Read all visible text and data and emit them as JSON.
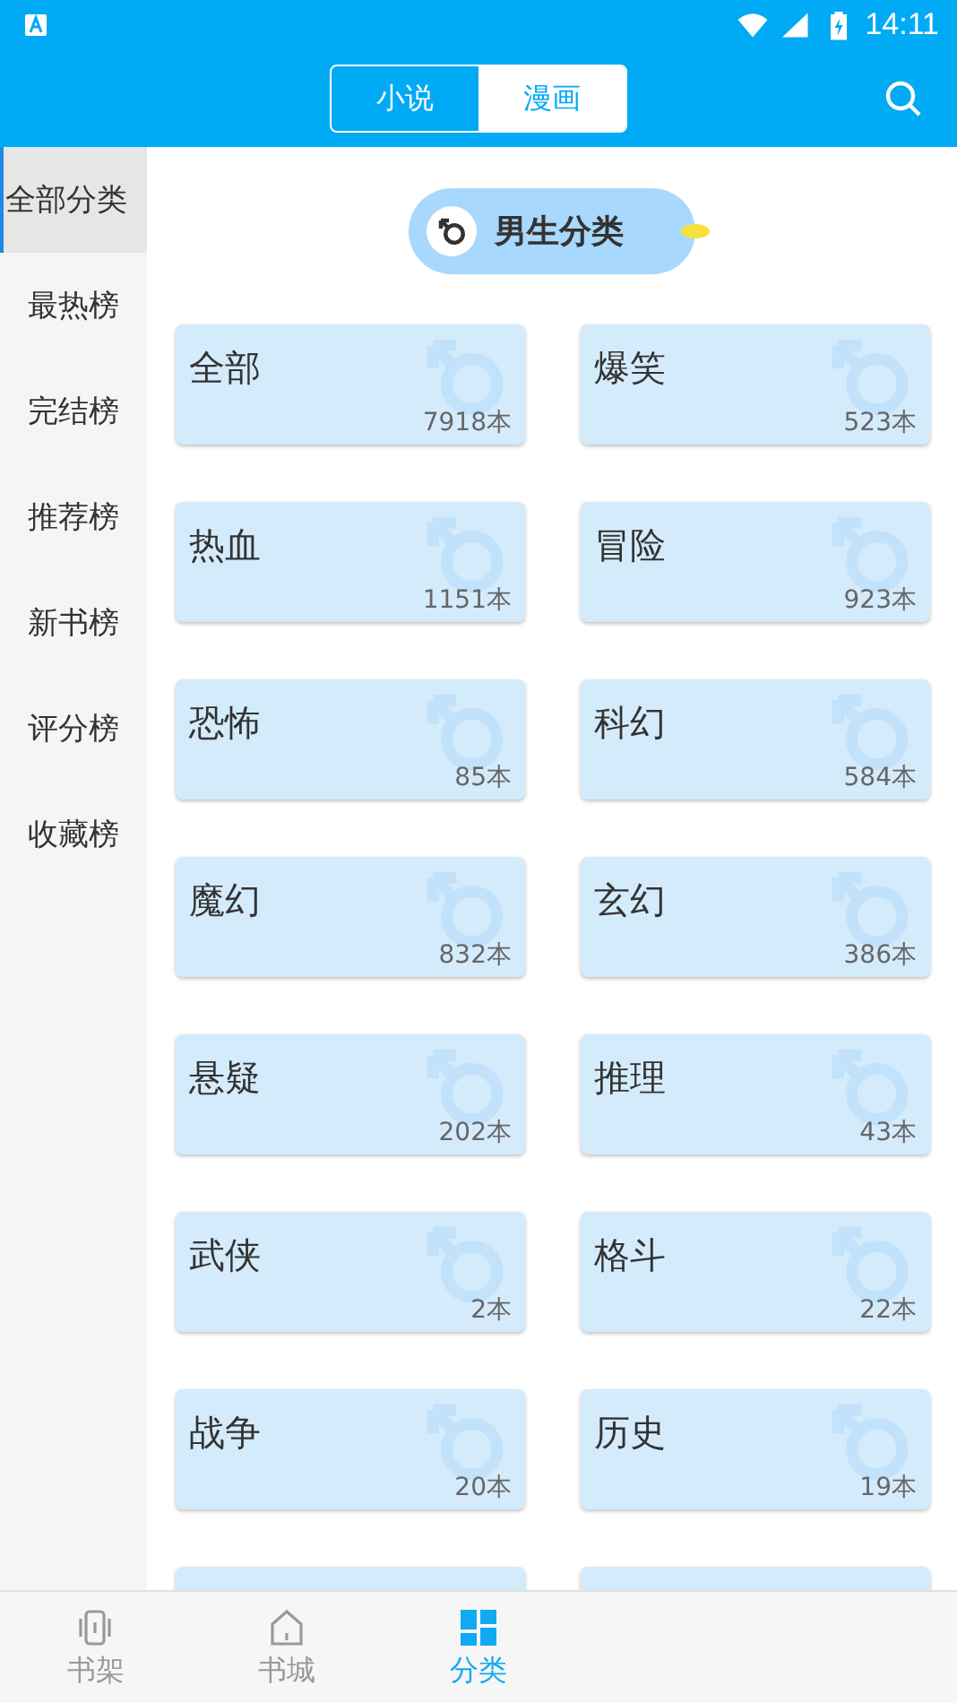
{
  "status_bar": {
    "time": "14:11"
  },
  "header": {
    "tabs": [
      {
        "label": "小说",
        "selected": false
      },
      {
        "label": "漫画",
        "selected": true
      }
    ]
  },
  "sidebar": {
    "items": [
      {
        "label": "全部分类",
        "selected": true
      },
      {
        "label": "最热榜",
        "selected": false
      },
      {
        "label": "完结榜",
        "selected": false
      },
      {
        "label": "推荐榜",
        "selected": false
      },
      {
        "label": "新书榜",
        "selected": false
      },
      {
        "label": "评分榜",
        "selected": false
      },
      {
        "label": "收藏榜",
        "selected": false
      }
    ]
  },
  "section": {
    "title": "男生分类"
  },
  "categories": [
    {
      "kind": "card",
      "name": "全部",
      "count": "7918本"
    },
    {
      "kind": "card",
      "name": "爆笑",
      "count": "523本"
    },
    {
      "kind": "card",
      "name": "热血",
      "count": "1151本"
    },
    {
      "kind": "card",
      "name": "冒险",
      "count": "923本"
    },
    {
      "kind": "card",
      "name": "恐怖",
      "count": "85本"
    },
    {
      "kind": "card",
      "name": "科幻",
      "count": "584本"
    },
    {
      "kind": "card",
      "name": "魔幻",
      "count": "832本"
    },
    {
      "kind": "card",
      "name": "玄幻",
      "count": "386本"
    },
    {
      "kind": "card",
      "name": "悬疑",
      "count": "202本"
    },
    {
      "kind": "card",
      "name": "推理",
      "count": "43本"
    },
    {
      "kind": "card",
      "name": "武侠",
      "count": "2本"
    },
    {
      "kind": "card",
      "name": "格斗",
      "count": "22本"
    },
    {
      "kind": "card",
      "name": "战争",
      "count": "20本"
    },
    {
      "kind": "card",
      "name": "历史",
      "count": "19本"
    },
    {
      "kind": "cut"
    },
    {
      "kind": "cut"
    }
  ],
  "bottom_nav": [
    {
      "label": "书架",
      "kind": "shelf",
      "selected": false
    },
    {
      "label": "书城",
      "kind": "home",
      "selected": false
    },
    {
      "label": "分类",
      "kind": "grid",
      "selected": true
    }
  ]
}
